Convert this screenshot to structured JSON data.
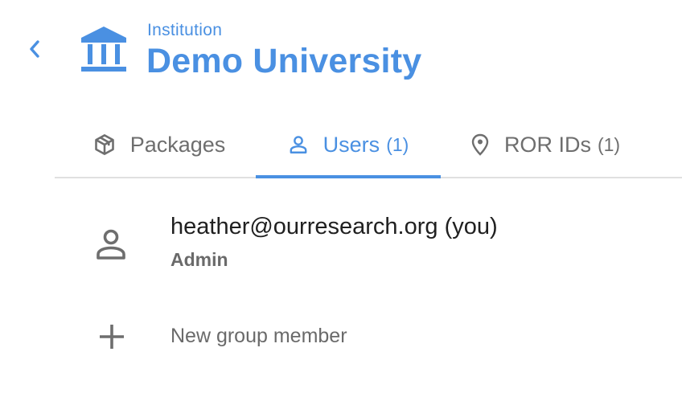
{
  "header": {
    "back_icon": "chevron-left-icon",
    "institution_icon": "bank-icon",
    "subtitle": "Institution",
    "title": "Demo University"
  },
  "tabs": [
    {
      "label": "Packages",
      "count": "",
      "icon": "package-icon",
      "active": false
    },
    {
      "label": "Users",
      "count": "(1)",
      "icon": "person-icon",
      "active": true
    },
    {
      "label": "ROR IDs",
      "count": "(1)",
      "icon": "map-pin-icon",
      "active": false
    }
  ],
  "users": [
    {
      "email": "heather@ourresearch.org (you)",
      "role": "Admin",
      "icon": "person-icon"
    }
  ],
  "new_member": {
    "label": "New group member",
    "icon": "plus-icon"
  },
  "colors": {
    "accent": "#4a90e2",
    "muted": "#6e6e6e",
    "divider": "#e0e0e0"
  }
}
